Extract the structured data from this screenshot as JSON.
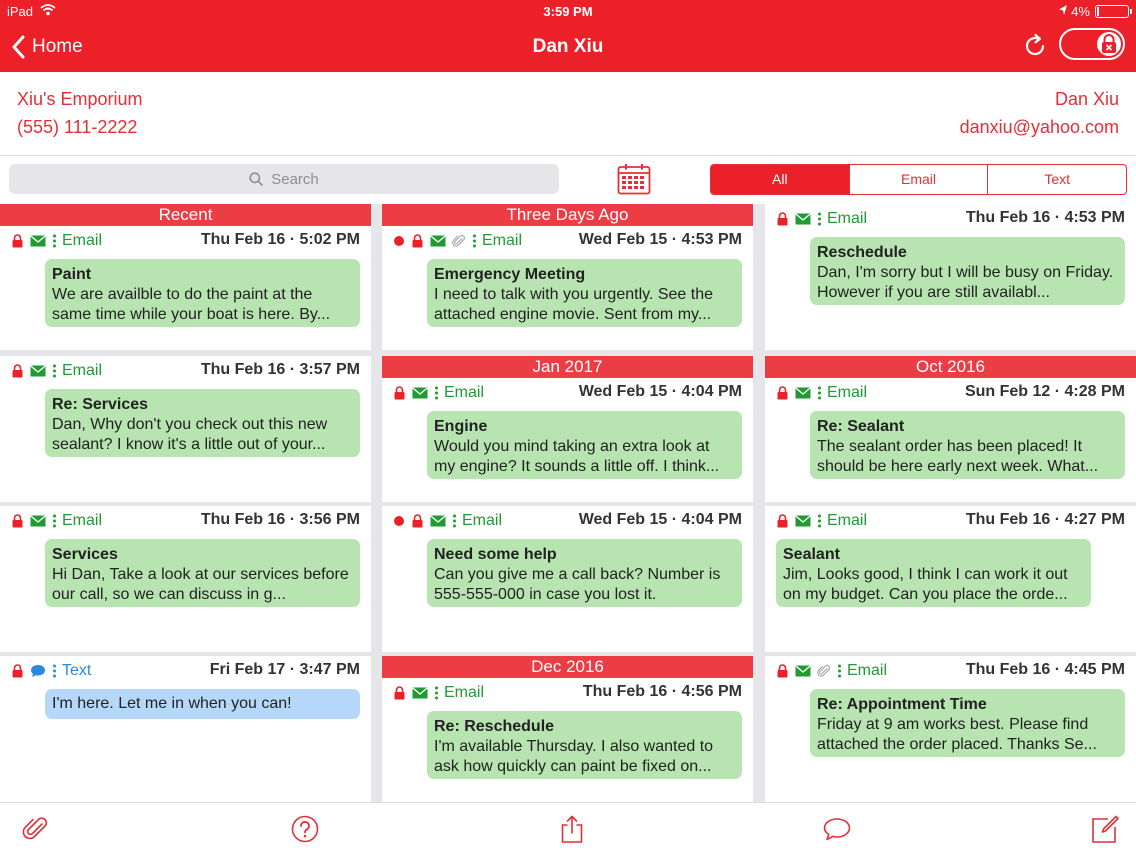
{
  "status_bar": {
    "carrier": "iPad",
    "time": "3:59 PM",
    "battery": "4%"
  },
  "nav": {
    "back_label": "Home",
    "title": "Dan Xiu"
  },
  "contact": {
    "company": "Xiu's Emporium",
    "phone": "(555) 111-2222",
    "name": "Dan Xiu",
    "email": "danxiu@yahoo.com"
  },
  "search": {
    "placeholder": "Search"
  },
  "filter": {
    "all": "All",
    "email": "Email",
    "text": "Text",
    "selected": "All"
  },
  "columns": [
    [
      {
        "header": "Recent",
        "kind": "Email",
        "date": "Thu Feb 16 · 5:02 PM",
        "subject": "Paint",
        "preview": "We are availble to do the paint at the same time while your boat is here. By..."
      },
      {
        "kind": "Email",
        "date": "Thu Feb 16 · 3:57 PM",
        "subject": "Re: Services",
        "preview": "Dan, Why don't you check out this new sealant? I know it's a little out of your..."
      },
      {
        "kind": "Email",
        "date": "Thu Feb 16 · 3:56 PM",
        "subject": "Services",
        "preview": "Hi Dan, Take a look at our services before our call, so we can discuss in g..."
      },
      {
        "kind": "Text",
        "date": "Fri Feb 17 · 3:47 PM",
        "message": "I'm here. Let me in when you can!"
      }
    ],
    [
      {
        "header": "Three Days Ago",
        "kind": "Email",
        "date": "Wed Feb 15 · 4:53 PM",
        "subject": "Emergency Meeting",
        "preview": "I need to talk with you urgently. See the attached engine movie.  Sent from my..."
      },
      {
        "header": "Jan 2017",
        "kind": "Email",
        "date": "Wed Feb 15 · 4:04 PM",
        "subject": "Engine",
        "preview": "Would you mind taking an extra look at my engine? It sounds a little off. I think..."
      },
      {
        "kind": "Email",
        "date": "Wed Feb 15 · 4:04 PM",
        "subject": "Need some help",
        "preview": "Can you give me a call back? Number is 555-555-000 in case you lost it."
      },
      {
        "header": "Dec 2016",
        "kind": "Email",
        "date": "Thu Feb 16 · 4:56 PM",
        "subject": "Re: Reschedule",
        "preview": "I'm available Thursday. I also wanted to ask how quickly can paint be fixed on..."
      }
    ],
    [
      {
        "kind": "Email",
        "date": "Thu Feb 16 · 4:53 PM",
        "subject": "Reschedule",
        "preview": "Dan,  I'm sorry but I will be busy on Friday. However if you are still availabl..."
      },
      {
        "header": "Oct 2016",
        "kind": "Email",
        "date": "Sun Feb 12 · 4:28 PM",
        "subject": "Re: Sealant",
        "preview": "The sealant order has been placed! It should be here early next week. What..."
      },
      {
        "kind": "Email",
        "date": "Thu Feb 16 · 4:27 PM",
        "subject": "Sealant",
        "preview": "Jim, Looks good, I think I can work it out on my budget. Can you place the orde..."
      },
      {
        "kind": "Email",
        "date": "Thu Feb 16 · 4:45 PM",
        "subject": "Re: Appointment Time",
        "preview": "Friday at 9 am works best. Please find attached the order placed. Thanks Se..."
      }
    ]
  ],
  "colors": {
    "brand_red": "#ec2028",
    "section_red": "#ec3d44",
    "email_green": "#1f9b31",
    "bubble_green": "#b7e4b0",
    "bubble_blue": "#b5d8fa",
    "text_blue": "#2a8bde"
  },
  "icons": [
    "back-chevron-icon",
    "refresh-icon",
    "lock-icon",
    "search-icon",
    "calendar-icon",
    "envelope-icon",
    "chat-bubble-icon",
    "paperclip-icon",
    "unread-dot-icon",
    "help-icon",
    "share-icon",
    "compose-icon"
  ]
}
